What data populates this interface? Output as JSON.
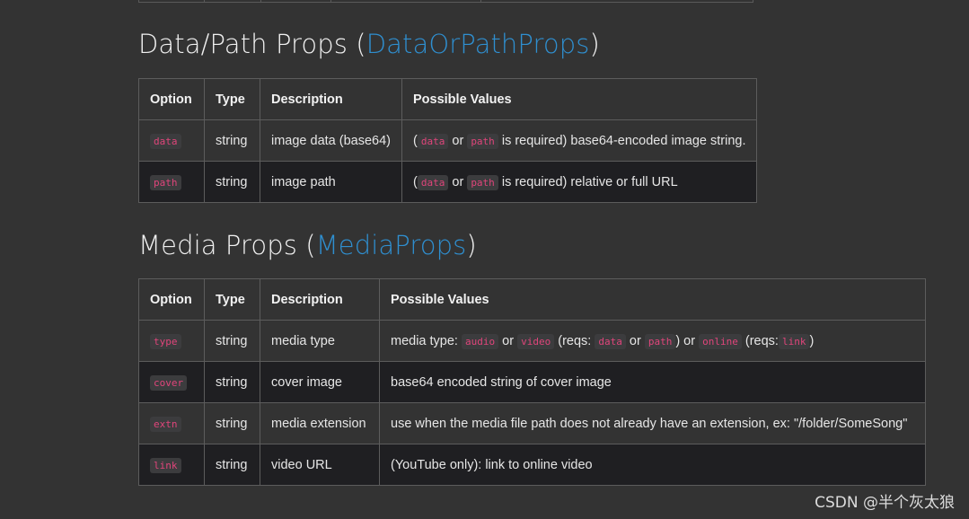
{
  "section1": {
    "title_prefix": "Data/Path Props (",
    "title_link": "DataOrPathProps",
    "title_suffix": ")",
    "headers": [
      "Option",
      "Type",
      "Description",
      "Possible Values"
    ],
    "rows": [
      {
        "option": "data",
        "type": "string",
        "description": "image data (base64)",
        "v1": "data",
        "v_or": "or",
        "v2": "path",
        "v_rest": "is required) base64-encoded image string."
      },
      {
        "option": "path",
        "type": "string",
        "description": "image path",
        "v1": "data",
        "v_or": "or",
        "v2": "path",
        "v_rest": "is required) relative or full URL"
      }
    ]
  },
  "section2": {
    "title_prefix": "Media Props (",
    "title_link": "MediaProps",
    "title_suffix": ")",
    "headers": [
      "Option",
      "Type",
      "Description",
      "Possible Values"
    ],
    "rows": [
      {
        "option": "type",
        "type": "string",
        "description": "media type"
      },
      {
        "option": "cover",
        "type": "string",
        "description": "cover image",
        "values": "base64 encoded string of cover image"
      },
      {
        "option": "extn",
        "type": "string",
        "description": "media extension",
        "values": "use when the media file path does not already have an extension, ex: \"/folder/SomeSong\""
      },
      {
        "option": "link",
        "type": "string",
        "description": "video URL",
        "values": "(YouTube only): link to online video"
      }
    ],
    "type_values": {
      "t1": "media type:",
      "c_audio": "audio",
      "t_or1": "or",
      "c_video": "video",
      "t2": "(reqs:",
      "c_data": "data",
      "t_or2": "or",
      "c_path": "path",
      "t3": ") or",
      "c_online": "online",
      "t4": "(reqs:",
      "c_link": "link",
      "t5": ")"
    }
  },
  "watermark": "CSDN @半个灰太狼"
}
